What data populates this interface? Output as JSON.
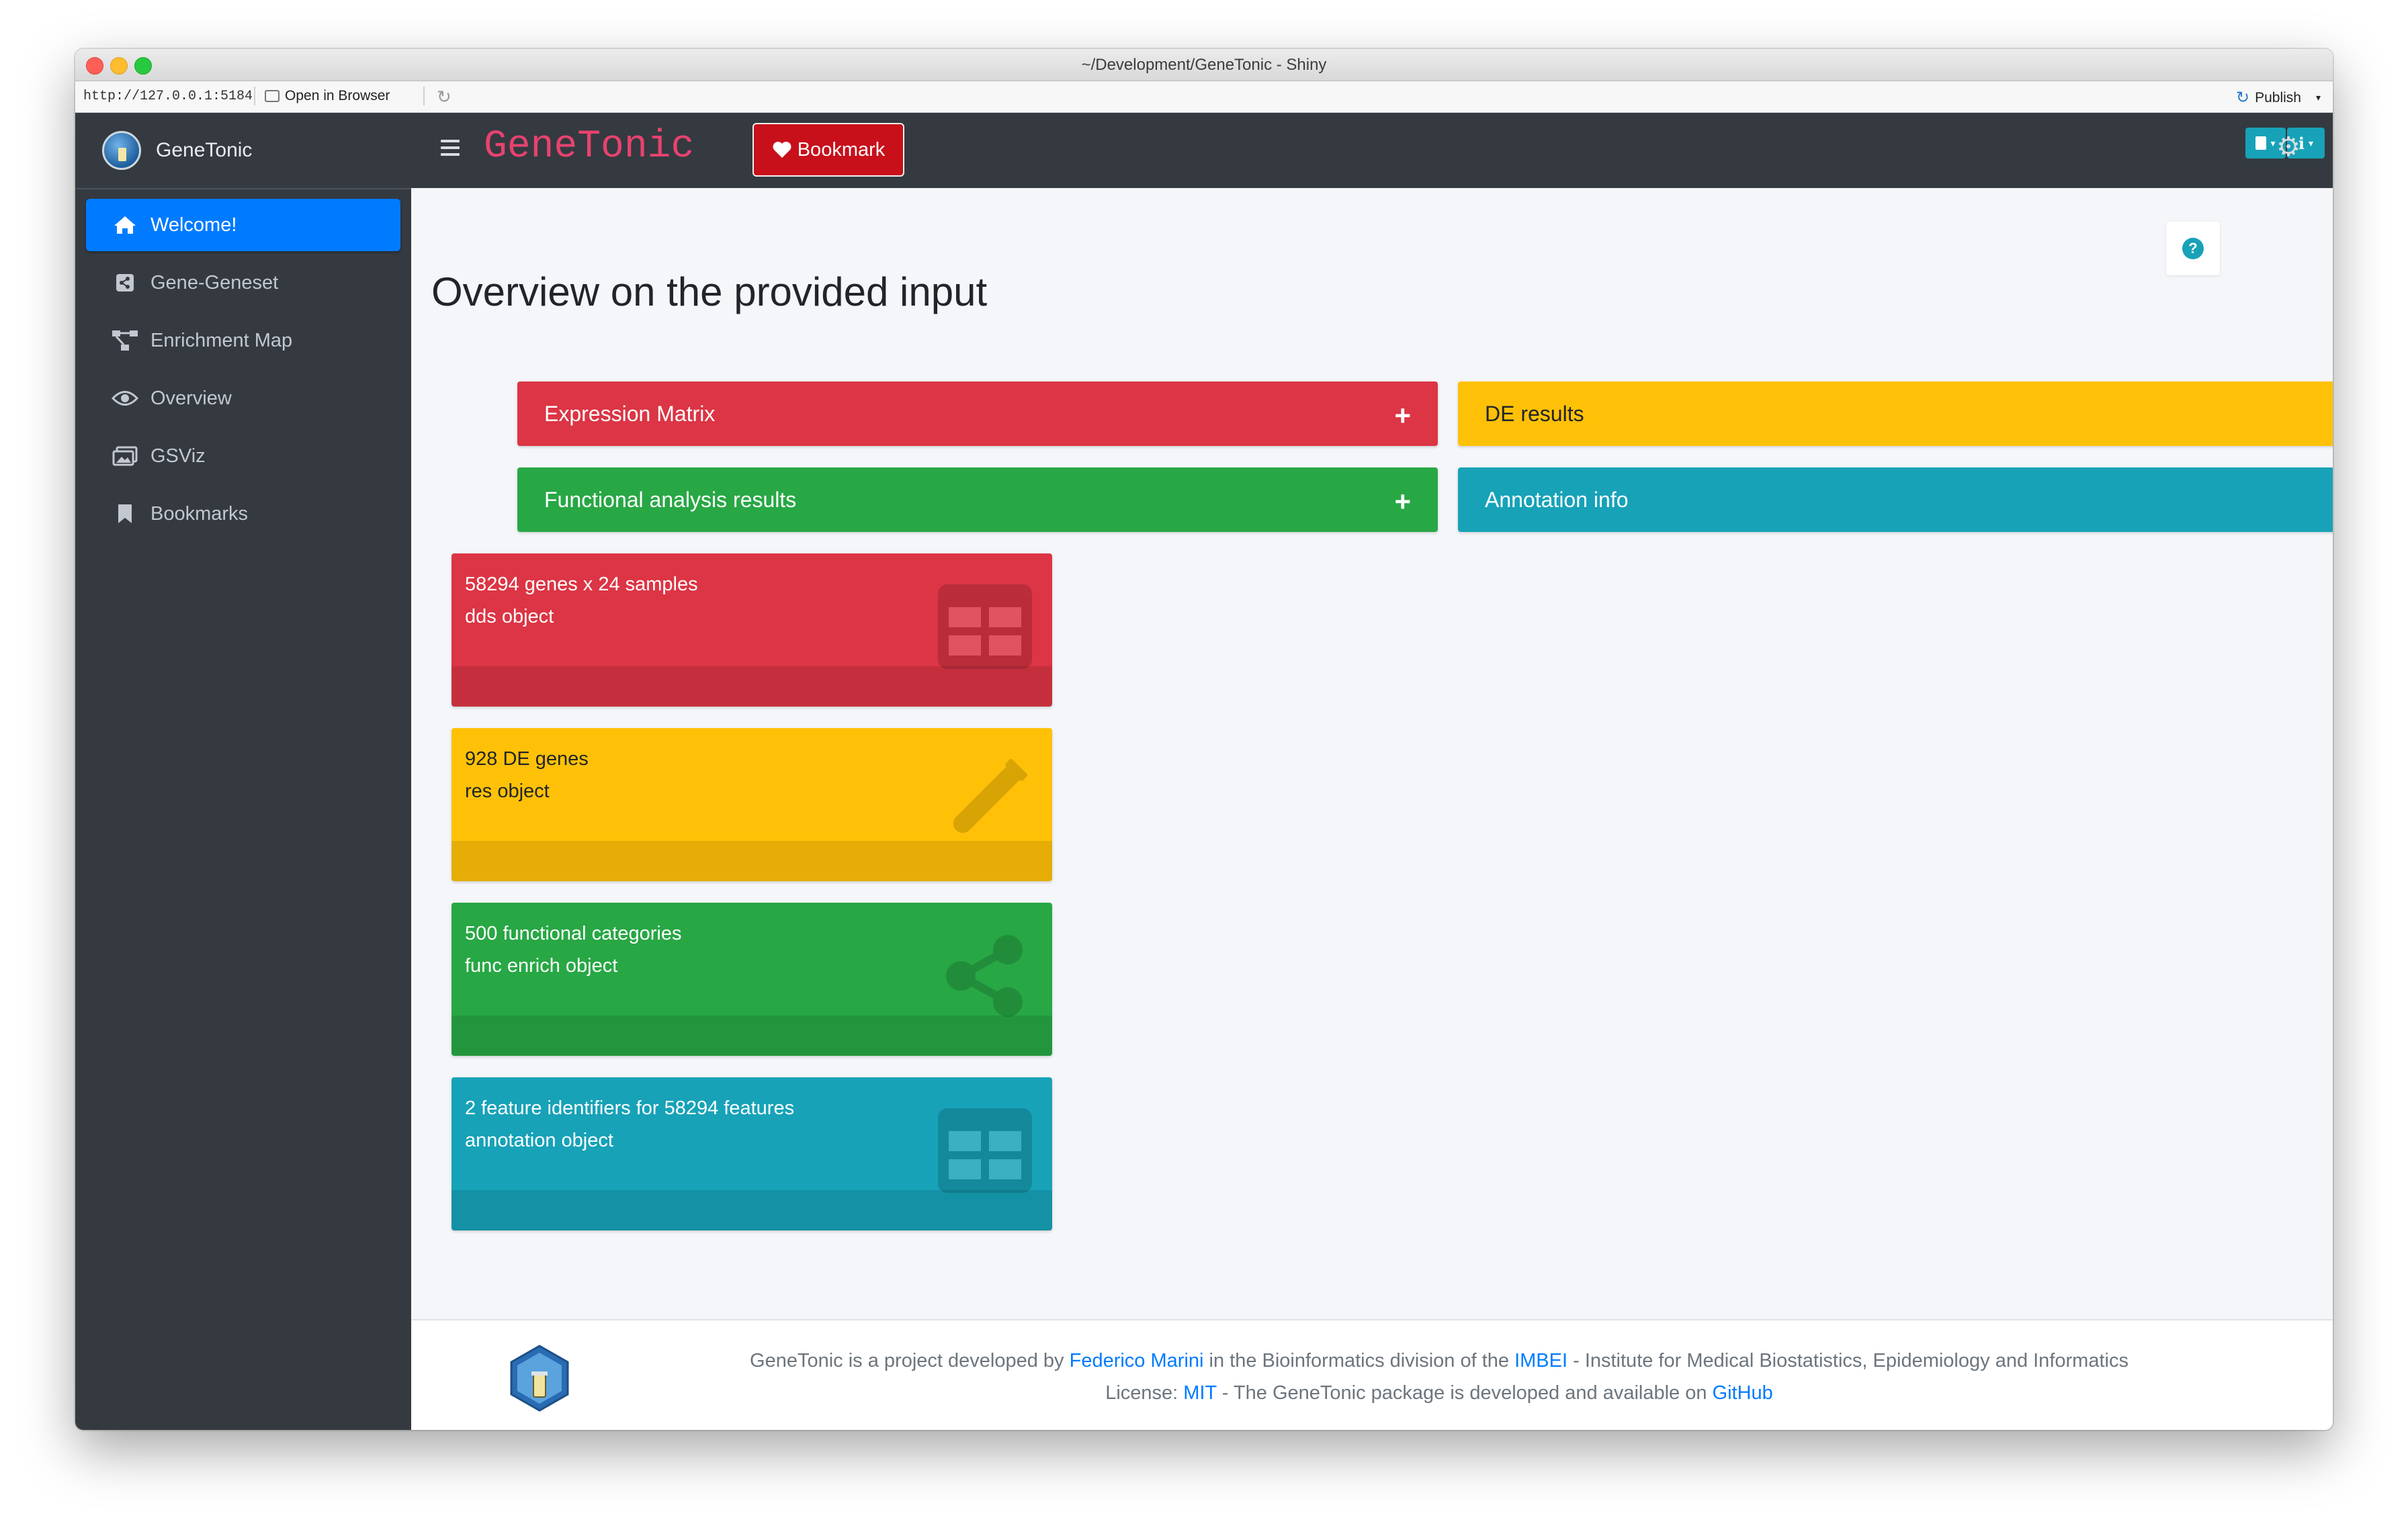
{
  "window": {
    "title": "~/Development/GeneTonic - Shiny"
  },
  "viewer": {
    "url": "http://127.0.0.1:5184",
    "open_in_browser": "Open in Browser",
    "publish": "Publish"
  },
  "brand": {
    "name": "GeneTonic"
  },
  "sidebar": {
    "items": [
      {
        "label": "Welcome!",
        "icon": "home-icon"
      },
      {
        "label": "Gene-Geneset",
        "icon": "share-square-icon"
      },
      {
        "label": "Enrichment Map",
        "icon": "project-diagram-icon"
      },
      {
        "label": "Overview",
        "icon": "eye-icon"
      },
      {
        "label": "GSViz",
        "icon": "images-icon"
      },
      {
        "label": "Bookmarks",
        "icon": "bookmark-icon"
      }
    ]
  },
  "header": {
    "app_title": "GeneTonic",
    "bookmark_label": "Bookmark",
    "info_label": "i"
  },
  "main": {
    "help_symbol": "?",
    "title": "Overview on the provided input",
    "panels": [
      {
        "label": "Expression Matrix",
        "plus": "+",
        "color": "#dc3545"
      },
      {
        "label": "DE results",
        "plus": "+",
        "color": "#ffc107"
      },
      {
        "label": "Functional analysis results",
        "plus": "+",
        "color": "#28a745"
      },
      {
        "label": "Annotation info",
        "plus": "+",
        "color": "#17a2b8"
      }
    ],
    "info_boxes": [
      {
        "line1": "58294 genes x 24 samples",
        "line2": "dds object",
        "icon": "table-icon"
      },
      {
        "line1": "928 DE genes",
        "line2": "res object",
        "icon": "vial-icon"
      },
      {
        "line1": "500 functional categories",
        "line2": "func enrich object",
        "icon": "share-alt-icon"
      },
      {
        "line1": "2 feature identifiers for 58294 features",
        "line2": "annotation object",
        "icon": "table-icon"
      }
    ]
  },
  "footer": {
    "line1_a": "GeneTonic is a project developed by ",
    "author": "Federico Marini",
    "line1_b": " in the Bioinformatics division of the ",
    "imbei": "IMBEI",
    "line1_c": " - Institute for Medical Biostatistics, Epidemiology and Informatics",
    "line2_a": "License: ",
    "license": "MIT",
    "line2_b": " - The GeneTonic package is developed and available on ",
    "github": "GitHub"
  }
}
